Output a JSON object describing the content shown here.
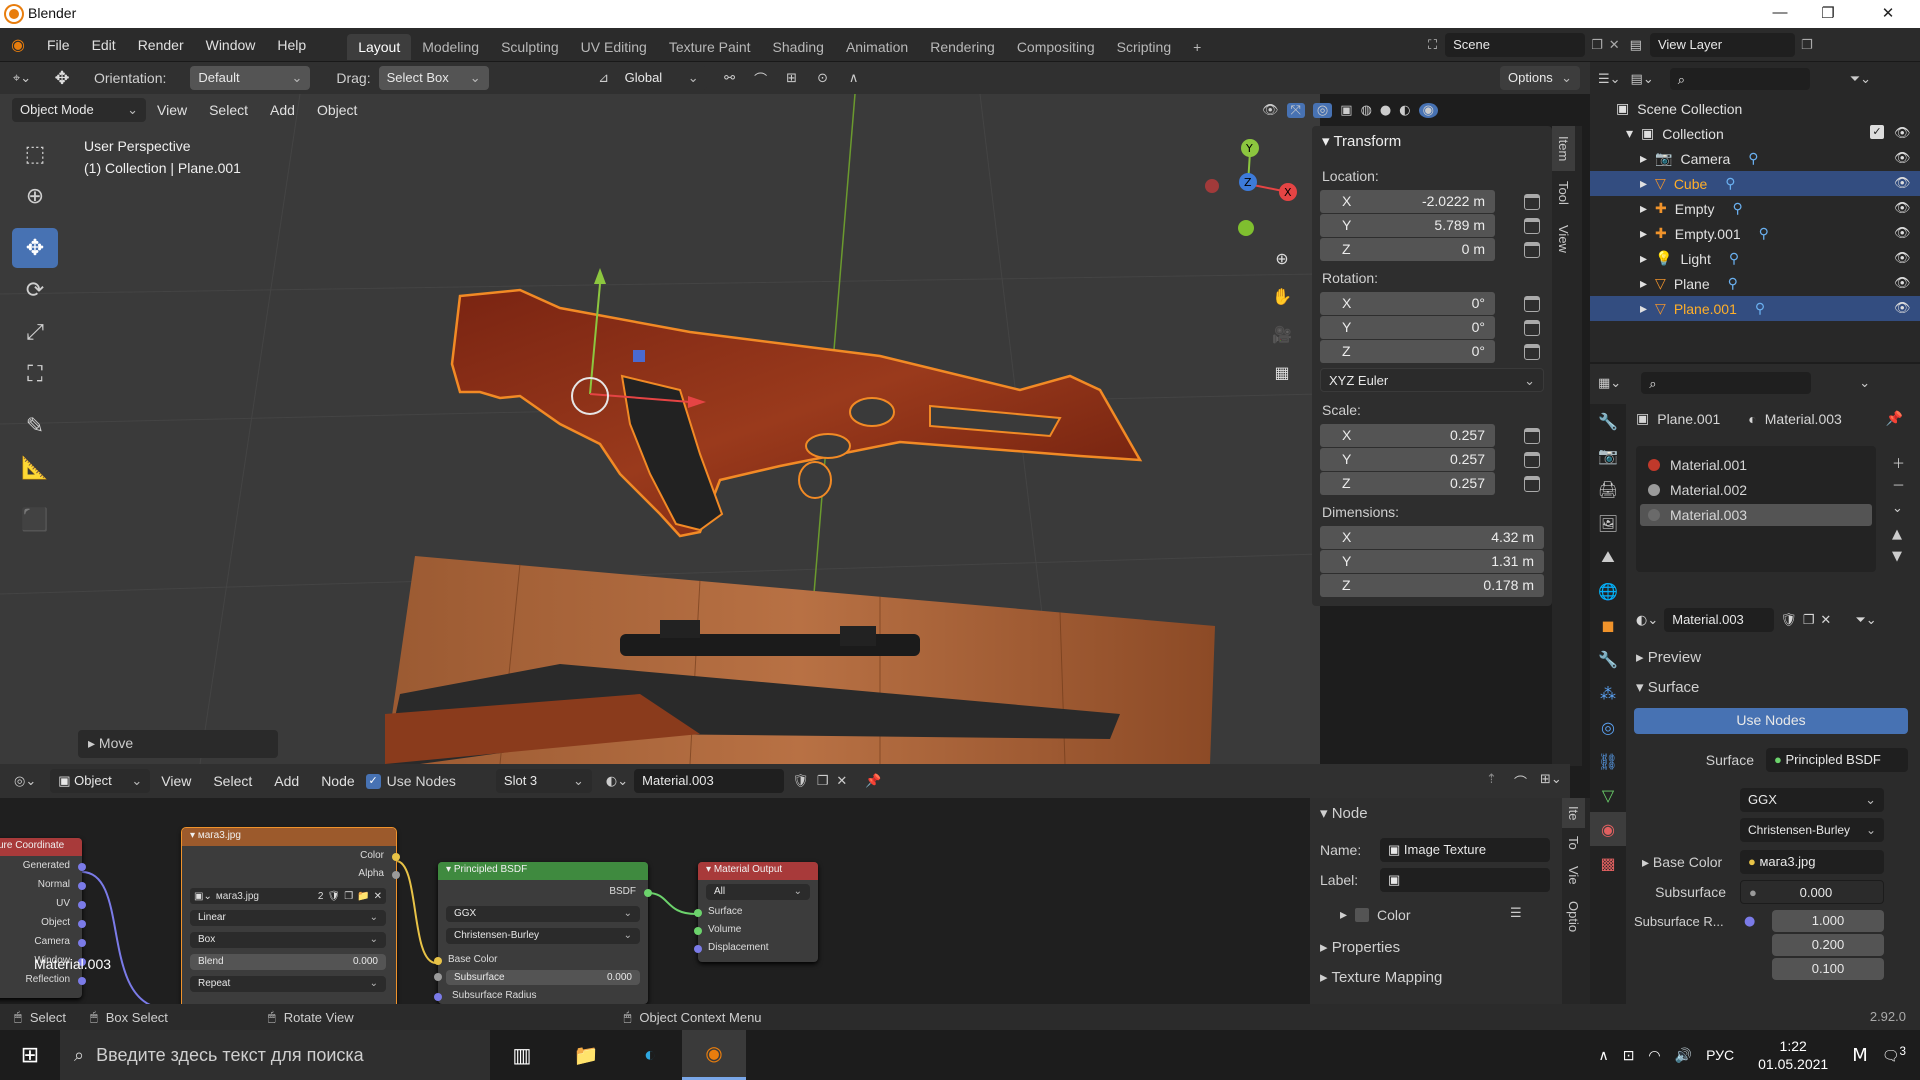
{
  "window": {
    "title": "Blender",
    "minimize": "—",
    "maximize": "❐",
    "close": "✕"
  },
  "menus": [
    "File",
    "Edit",
    "Render",
    "Window",
    "Help"
  ],
  "workspaces": [
    "Layout",
    "Modeling",
    "Sculpting",
    "UV Editing",
    "Texture Paint",
    "Shading",
    "Animation",
    "Rendering",
    "Compositing",
    "Scripting",
    "+"
  ],
  "active_workspace": "Layout",
  "scene": {
    "name": "Scene",
    "view_layer": "View Layer"
  },
  "toolsettings": {
    "orientation_label": "Orientation:",
    "orientation_value": "Default",
    "drag_label": "Drag:",
    "drag_value": "Select Box",
    "transform_space": "Global",
    "options": "Options"
  },
  "viewport_header": {
    "mode": "Object Mode",
    "menus": [
      "View",
      "Select",
      "Add",
      "Object"
    ]
  },
  "viewport": {
    "overlay_line1": "User Perspective",
    "overlay_line2": "(1) Collection | Plane.001",
    "last_op": "Move",
    "gizmo": {
      "x": "X",
      "y": "Y",
      "z": "Z"
    }
  },
  "transform": {
    "title": "Transform",
    "location_label": "Location:",
    "location": [
      {
        "axis": "X",
        "value": "-2.0222 m"
      },
      {
        "axis": "Y",
        "value": "5.789 m"
      },
      {
        "axis": "Z",
        "value": "0 m"
      }
    ],
    "rotation_label": "Rotation:",
    "rotation": [
      {
        "axis": "X",
        "value": "0°"
      },
      {
        "axis": "Y",
        "value": "0°"
      },
      {
        "axis": "Z",
        "value": "0°"
      }
    ],
    "rotation_mode": "XYZ Euler",
    "scale_label": "Scale:",
    "scale": [
      {
        "axis": "X",
        "value": "0.257"
      },
      {
        "axis": "Y",
        "value": "0.257"
      },
      {
        "axis": "Z",
        "value": "0.257"
      }
    ],
    "dimensions_label": "Dimensions:",
    "dimensions": [
      {
        "axis": "X",
        "value": "4.32 m"
      },
      {
        "axis": "Y",
        "value": "1.31 m"
      },
      {
        "axis": "Z",
        "value": "0.178 m"
      }
    ]
  },
  "side_tabs": [
    "Item",
    "Tool",
    "View"
  ],
  "outliner": {
    "scene_collection": "Scene Collection",
    "collection": "Collection",
    "items": [
      {
        "name": "Camera",
        "selected": false,
        "highlight": false
      },
      {
        "name": "Cube",
        "selected": true,
        "highlight": true
      },
      {
        "name": "Empty",
        "selected": false,
        "highlight": false
      },
      {
        "name": "Empty.001",
        "selected": false,
        "highlight": false
      },
      {
        "name": "Light",
        "selected": false,
        "highlight": false
      },
      {
        "name": "Plane",
        "selected": false,
        "highlight": false
      },
      {
        "name": "Plane.001",
        "selected": true,
        "highlight": true
      }
    ]
  },
  "properties": {
    "object": "Plane.001",
    "material": "Material.003",
    "slots": [
      "Material.001",
      "Material.002",
      "Material.003"
    ],
    "slot_colors": [
      "#c0392b",
      "#9a9a9a",
      "#6a6a6a"
    ],
    "active_slot": 2,
    "preview": "Preview",
    "surface_panel": "Surface",
    "use_nodes": "Use Nodes",
    "surface_label": "Surface",
    "surface_value": "Principled BSDF",
    "distribution": "GGX",
    "subsurface_method": "Christensen-Burley",
    "base_color_label": "Base Color",
    "base_color_value": "мага3.jpg",
    "subsurface_label": "Subsurface",
    "subsurface_value": "0.000",
    "subsurface_radius_label": "Subsurface R...",
    "subsurface_radius": [
      "1.000",
      "0.200",
      "0.100"
    ]
  },
  "node_editor": {
    "header": {
      "type": "Object",
      "menus": [
        "View",
        "Select",
        "Add",
        "Node"
      ],
      "use_nodes": "Use Nodes",
      "slot": "Slot 3",
      "material": "Material.003"
    },
    "material_label": "Material.003",
    "texcoord": {
      "title": "ure Coordinate",
      "outputs": [
        "Generated",
        "Normal",
        "UV",
        "Object",
        "Camera",
        "Window",
        "Reflection"
      ]
    },
    "image": {
      "title": "мага3.jpg",
      "outputs": [
        "Color",
        "Alpha"
      ],
      "file": "мага3.jpg",
      "users": "2",
      "interp": "Linear",
      "proj": "Box",
      "blend_label": "Blend",
      "blend_value": "0.000",
      "ext": "Repeat"
    },
    "bsdf": {
      "title": "Principled BSDF",
      "output": "BSDF",
      "dist": "GGX",
      "sss": "Christensen-Burley",
      "inputs": [
        "Base Color",
        "Subsurface",
        "Subsurface Radius"
      ],
      "subsurface_value": "0.000"
    },
    "output": {
      "title": "Material Output",
      "target": "All",
      "inputs": [
        "Surface",
        "Volume",
        "Displacement"
      ]
    }
  },
  "node_panel": {
    "title": "Node",
    "name_label": "Name:",
    "name_value": "Image Texture",
    "label_label": "Label:",
    "color": "Color",
    "properties": "Properties",
    "texture_mapping": "Texture Mapping",
    "tabs": [
      "Ite",
      "To",
      "Vie",
      "Optio"
    ]
  },
  "statusbar": {
    "select": "Select",
    "box_select": "Box Select",
    "rotate": "Rotate View",
    "context": "Object Context Menu",
    "version": "2.92.0"
  },
  "taskbar": {
    "search_placeholder": "Введите здесь текст для поиска",
    "lang": "РУС",
    "time": "1:22",
    "date": "01.05.2021",
    "notif": "3"
  },
  "colors": {
    "accent": "#4772b3",
    "selection_orange": "#ffaf29",
    "header": "#303030"
  }
}
